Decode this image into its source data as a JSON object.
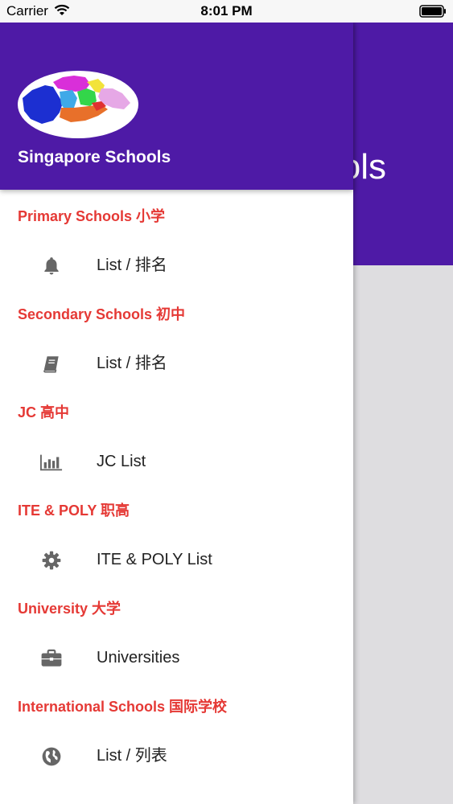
{
  "status_bar": {
    "carrier": "Carrier",
    "time": "8:01 PM"
  },
  "background_page": {
    "title_fragment": "ols",
    "header_color": "#4e1aa6"
  },
  "drawer": {
    "title": "Singapore Schools",
    "header_color": "#4e1aa6",
    "section_color": "#e53935",
    "sections": [
      {
        "title": "Primary Schools 小学",
        "item_label": "List / 排名",
        "icon": "bell-icon"
      },
      {
        "title": "Secondary Schools 初中",
        "item_label": "List / 排名",
        "icon": "book-icon"
      },
      {
        "title": "JC 高中",
        "item_label": "JC List",
        "icon": "bar-chart-icon"
      },
      {
        "title": "ITE & POLY 职高",
        "item_label": "ITE & POLY List",
        "icon": "gear-icon"
      },
      {
        "title": "University 大学",
        "item_label": "Universities",
        "icon": "briefcase-icon"
      },
      {
        "title": "International Schools 国际学校",
        "item_label": "List / 列表",
        "icon": "globe-icon"
      }
    ]
  }
}
